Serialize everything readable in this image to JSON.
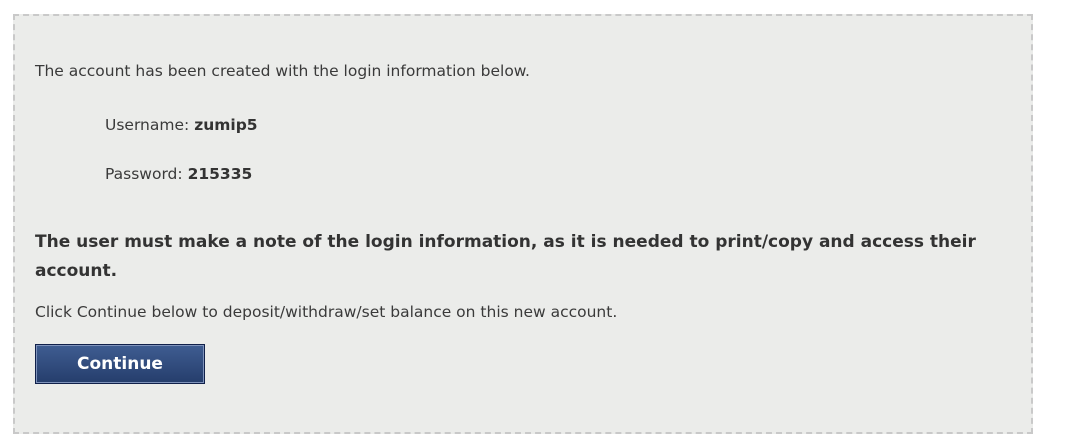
{
  "message": {
    "intro": "The account has been created with the login information below.",
    "username_label": "Username:",
    "username_value": "zumip5",
    "password_label": "Password:",
    "password_value": "215335",
    "note": "The user must make a note of the login information, as it is needed to print/copy and access their account.",
    "cta_text": "Click Continue below to deposit/withdraw/set balance on this new account."
  },
  "actions": {
    "continue_label": "Continue"
  },
  "colors": {
    "panel_background": "#ebecea",
    "panel_border": "#c9c9c9",
    "button_background": "#2f4a7d",
    "text": "#333333"
  }
}
